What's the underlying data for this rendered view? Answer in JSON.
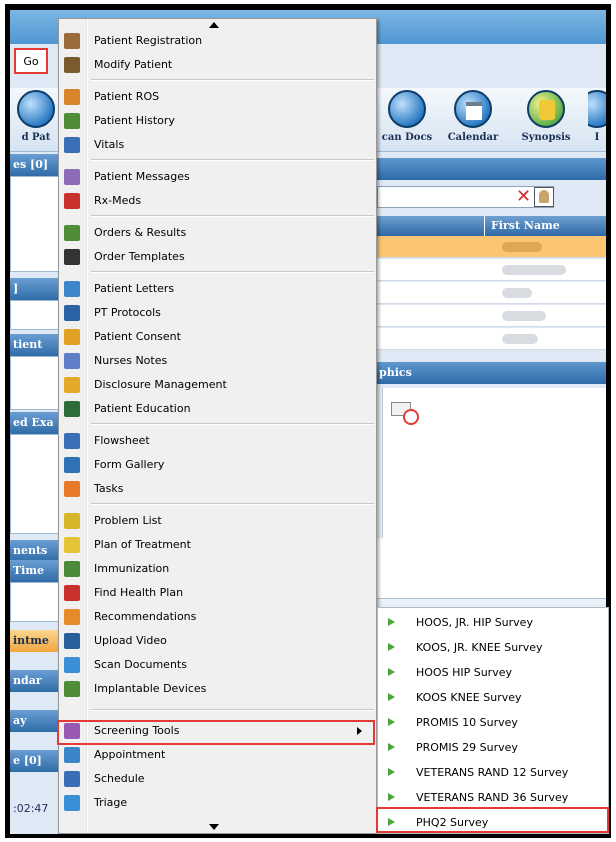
{
  "app": {
    "go_label": "Go",
    "toolbar": [
      "d Pat",
      "can Docs",
      "Calendar",
      "Synopsis",
      "I"
    ],
    "side_headers": [
      {
        "label": "es [0]",
        "style": "blue"
      },
      {
        "label": "]",
        "style": "blue"
      },
      {
        "label": "tient",
        "style": "blue"
      },
      {
        "label": "ed Exa",
        "style": "blue"
      },
      {
        "label": "nents",
        "style": "blue"
      },
      {
        "label": "Time",
        "style": "blue"
      },
      {
        "label": "intme",
        "style": "orange"
      },
      {
        "label": "ndar",
        "style": "blue"
      },
      {
        "label": "ay",
        "style": "blue"
      },
      {
        "label": "e [0]",
        "style": "blue"
      },
      {
        "label": ":02:47",
        "style": "light"
      }
    ],
    "grid_header": "First Name",
    "graphics_header": "phics"
  },
  "menu": {
    "items": [
      {
        "label": "Patient Registration",
        "icon": "registration-icon",
        "color": "#9c6b3c"
      },
      {
        "label": "Modify Patient",
        "icon": "modify-patient-icon",
        "color": "#7b5a2e"
      },
      {
        "label": "Patient ROS",
        "icon": "ros-icon",
        "color": "#d9862b"
      },
      {
        "label": "Patient History",
        "icon": "history-icon",
        "color": "#4f8c3a"
      },
      {
        "label": "Vitals",
        "icon": "vitals-icon",
        "color": "#3b6fb5"
      },
      {
        "label": "Patient Messages",
        "icon": "messages-icon",
        "color": "#8d6bb5"
      },
      {
        "label": "Rx-Meds",
        "icon": "rx-meds-icon",
        "color": "#c9302c"
      },
      {
        "label": "Orders & Results",
        "icon": "orders-icon",
        "color": "#4f8c3a"
      },
      {
        "label": "Order Templates",
        "icon": "templates-icon",
        "color": "#333333"
      },
      {
        "label": "Patient Letters",
        "icon": "letters-icon",
        "color": "#3a86c8"
      },
      {
        "label": "PT Protocols",
        "icon": "protocols-icon",
        "color": "#2c63a6"
      },
      {
        "label": "Patient Consent",
        "icon": "consent-icon",
        "color": "#e0a125"
      },
      {
        "label": "Nurses Notes",
        "icon": "nurse-icon",
        "color": "#5e7ec7"
      },
      {
        "label": "Disclosure Management",
        "icon": "disclosure-icon",
        "color": "#e5a92a"
      },
      {
        "label": "Patient Education",
        "icon": "education-icon",
        "color": "#2d6c3a"
      },
      {
        "label": "Flowsheet",
        "icon": "flowsheet-icon",
        "color": "#3a6fb8"
      },
      {
        "label": "Form Gallery",
        "icon": "form-gallery-icon",
        "color": "#2f73b6"
      },
      {
        "label": "Tasks",
        "icon": "tasks-icon",
        "color": "#e87b27"
      },
      {
        "label": "Problem List",
        "icon": "problem-list-icon",
        "color": "#d7b62a"
      },
      {
        "label": "Plan of Treatment",
        "icon": "treatment-icon",
        "color": "#e5c438"
      },
      {
        "label": "Immunization",
        "icon": "immunization-icon",
        "color": "#4b8a3a"
      },
      {
        "label": "Find Health Plan",
        "icon": "health-plan-icon",
        "color": "#c9302c"
      },
      {
        "label": "Recommendations",
        "icon": "recommendations-icon",
        "color": "#e58b2a"
      },
      {
        "label": "Upload Video",
        "icon": "video-icon",
        "color": "#2a5d9b"
      },
      {
        "label": "Scan Documents",
        "icon": "scan-icon",
        "color": "#3b8fd6"
      },
      {
        "label": "Implantable Devices",
        "icon": "devices-icon",
        "color": "#4f8c3a"
      },
      {
        "label": "Screening Tools",
        "icon": "screening-icon",
        "color": "#9b59b6"
      },
      {
        "label": "Appointment",
        "icon": "appointment-icon",
        "color": "#3a86c8"
      },
      {
        "label": "Schedule",
        "icon": "schedule-icon",
        "color": "#3a6fb8"
      },
      {
        "label": "Triage",
        "icon": "triage-icon",
        "color": "#3b8fd6"
      }
    ]
  },
  "submenu": {
    "items": [
      "HOOS, JR. HIP Survey",
      "KOOS, JR. KNEE Survey",
      "HOOS HIP Survey",
      "KOOS KNEE Survey",
      "PROMIS 10 Survey",
      "PROMIS 29 Survey",
      "VETERANS RAND 12 Survey",
      "VETERANS RAND 36 Survey",
      "PHQ2 Survey"
    ]
  }
}
